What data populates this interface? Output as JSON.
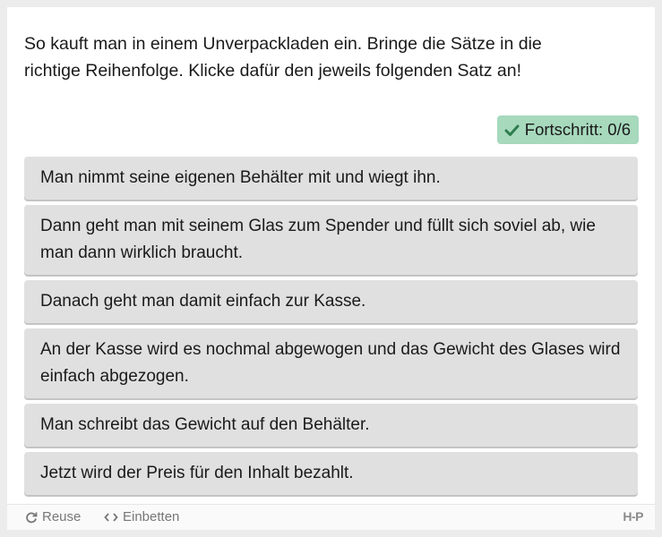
{
  "question": "So kauft man in einem Unverpackladen ein. Bringe die Sätze in die richtige Reihenfolge. Klicke dafür den jeweils folgenden Satz an!",
  "progress": {
    "label": "Fortschritt: 0/6",
    "current": 0,
    "total": 6,
    "color": "#a7d9bd"
  },
  "sentences": [
    "Man nimmt seine eigenen Behälter mit und wiegt ihn.",
    "Dann geht man mit seinem Glas zum Spender und füllt sich soviel ab, wie man dann wirklich braucht.",
    "Danach geht man damit einfach zur Kasse.",
    "An der Kasse wird es nochmal abgewogen und das Gewicht des Glases wird einfach abgezogen.",
    "Man schreibt das Gewicht auf den Behälter.",
    "Jetzt wird der Preis für den Inhalt bezahlt."
  ],
  "footer": {
    "reuse_label": "Reuse",
    "embed_label": "Einbetten",
    "logo_text": "H-P",
    "reuse_icon": "reuse-icon",
    "embed_icon": "code-icon"
  }
}
